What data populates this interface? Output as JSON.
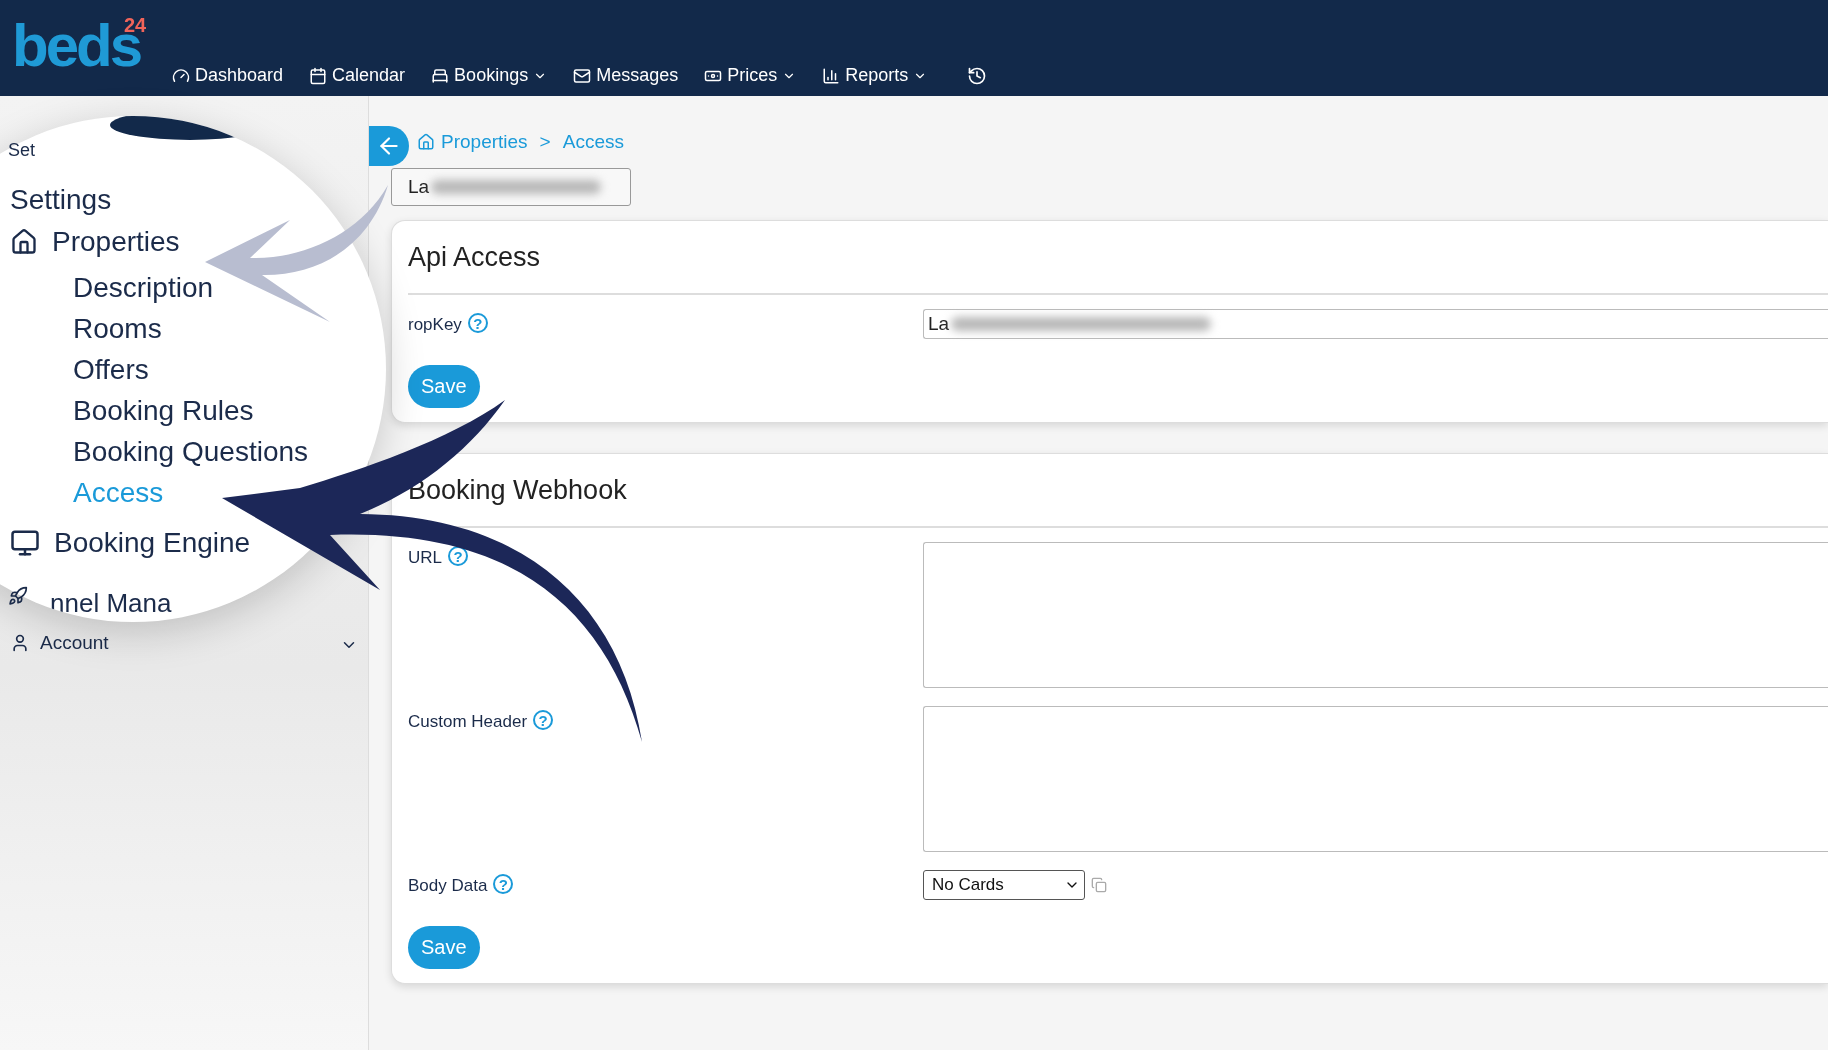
{
  "logo": {
    "text": "beds",
    "superscript": "24"
  },
  "nav": [
    {
      "label": "Dashboard",
      "dropdown": false
    },
    {
      "label": "Calendar",
      "dropdown": false
    },
    {
      "label": "Bookings",
      "dropdown": true
    },
    {
      "label": "Messages",
      "dropdown": false
    },
    {
      "label": "Prices",
      "dropdown": true
    },
    {
      "label": "Reports",
      "dropdown": true
    }
  ],
  "sidebar": {
    "heading_partial": "Set",
    "account": "Account",
    "magnifier": {
      "heading": "Settings",
      "section": "Properties",
      "items": [
        {
          "label": "Description",
          "selected": false
        },
        {
          "label": "Rooms",
          "selected": false
        },
        {
          "label": "Offers",
          "selected": false
        },
        {
          "label": "Booking Rules",
          "selected": false
        },
        {
          "label": "Booking Questions",
          "selected": false
        },
        {
          "label": "Access",
          "selected": true
        }
      ],
      "next_section": "Booking Engine",
      "cut_item": "nnel Mana"
    }
  },
  "breadcrumb": [
    "Properties",
    "Access"
  ],
  "breadcrumb_separator": ">",
  "property_select": {
    "value": "La"
  },
  "cards": [
    {
      "title": "Api Access",
      "fields": [
        {
          "kind": "input",
          "label": "ropKey",
          "help": "?",
          "value": "La"
        }
      ],
      "button": "Save"
    },
    {
      "title": "Booking Webhook",
      "fields": [
        {
          "kind": "textarea",
          "label": "URL",
          "help": "?"
        },
        {
          "kind": "textarea",
          "label": "Custom Header",
          "help": "?"
        },
        {
          "kind": "select",
          "label": "Body Data",
          "help": "?",
          "value": "No Cards"
        }
      ],
      "button": "Save"
    }
  ]
}
